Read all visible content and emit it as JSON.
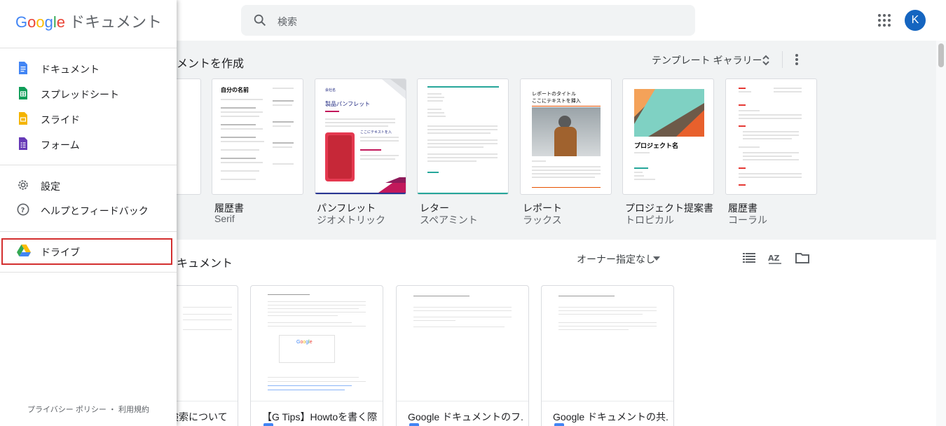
{
  "header": {
    "search_placeholder": "検索",
    "avatar_initial": "K"
  },
  "templates": {
    "section_title": "メントを作成",
    "gallery_label": "テンプレート ギャラリー",
    "items": [
      {
        "name": "履歴書",
        "subtitle": "Serif",
        "preview_title": "自分の名前"
      },
      {
        "name": "パンフレット",
        "subtitle": "ジオメトリック",
        "preview_title": "製品パンフレット",
        "preview_company": "会社名",
        "preview_heading": "ここにテキストを入"
      },
      {
        "name": "レター",
        "subtitle": "スペアミント"
      },
      {
        "name": "レポート",
        "subtitle": "ラックス",
        "preview_title": "レポートのタイトル",
        "preview_sub": "ここにテキストを挿入"
      },
      {
        "name": "プロジェクト提案書",
        "subtitle": "トロピカル",
        "preview_title": "プロジェクト名"
      },
      {
        "name": "履歴書",
        "subtitle": "コーラル"
      }
    ]
  },
  "recent": {
    "section_title": "キュメント",
    "owner_filter": "オーナー指定なし",
    "docs": [
      {
        "name": "検索について"
      },
      {
        "name": "【G Tips】Howtoを書く際..."
      },
      {
        "name": "Google ドキュメントのフ..."
      },
      {
        "name": "Google ドキュメントの共..."
      }
    ]
  },
  "drawer": {
    "brand_google": [
      "G",
      "o",
      "o",
      "g",
      "l",
      "e"
    ],
    "brand_product": "ドキュメント",
    "items": [
      {
        "label": "ドキュメント",
        "icon": "docs-icon"
      },
      {
        "label": "スプレッドシート",
        "icon": "sheets-icon"
      },
      {
        "label": "スライド",
        "icon": "slides-icon"
      },
      {
        "label": "フォーム",
        "icon": "forms-icon"
      },
      {
        "label": "設定",
        "icon": "gear-icon"
      },
      {
        "label": "ヘルプとフィードバック",
        "icon": "help-icon"
      },
      {
        "label": "ドライブ",
        "icon": "drive-icon"
      }
    ],
    "footer": "プライバシー ポリシー ・ 利用規約"
  },
  "colors": {
    "docs": "#4285f4",
    "sheets": "#0f9d58",
    "slides": "#f4b400",
    "forms": "#673ab7",
    "highlight": "#d32f2f"
  }
}
